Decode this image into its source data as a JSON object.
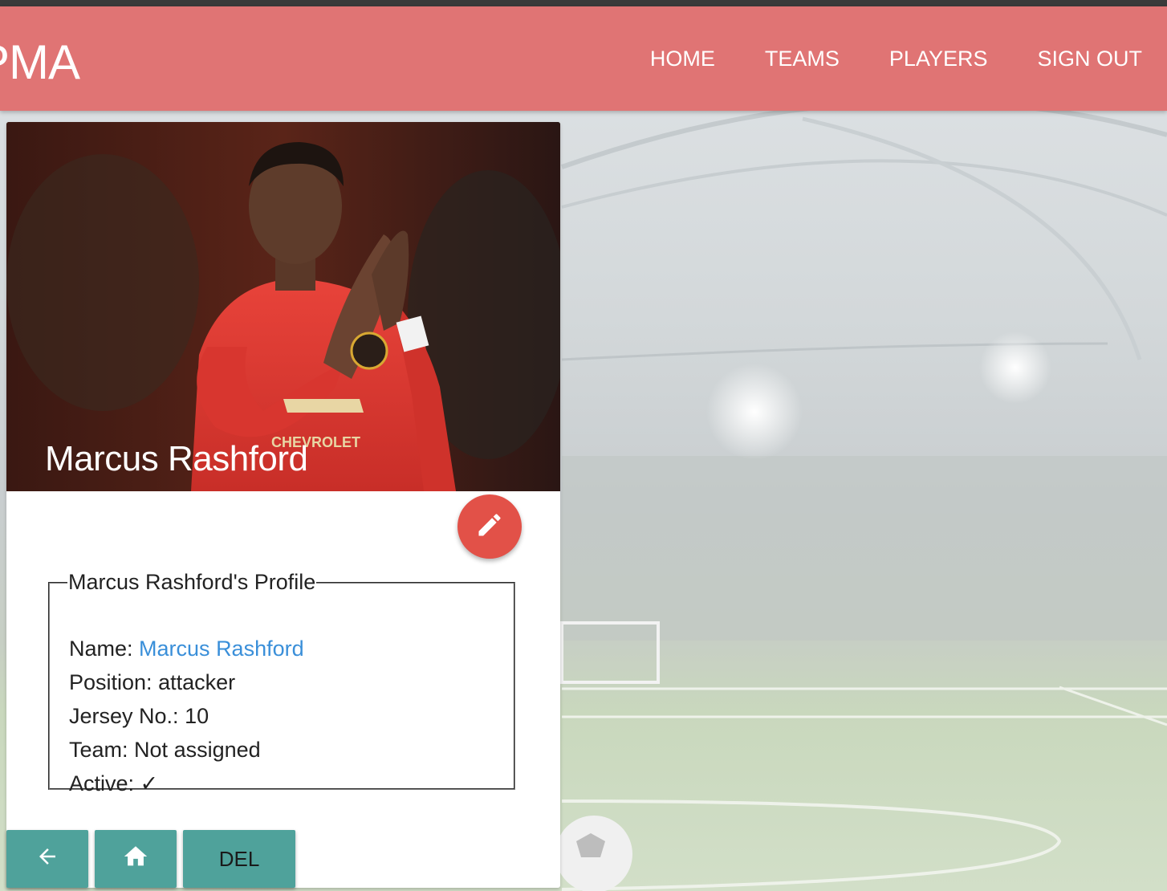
{
  "header": {
    "brand": "PMA",
    "nav": [
      "HOME",
      "TEAMS",
      "PLAYERS",
      "SIGN OUT"
    ]
  },
  "card": {
    "title": "Marcus Rashford",
    "profile": {
      "legend": "Marcus Rashford's Profile",
      "name_label": "Name:",
      "name_value": "Marcus Rashford",
      "position_label": "Position:",
      "position_value": "attacker",
      "jersey_label": "Jersey No.:",
      "jersey_value": "10",
      "team_label": "Team:",
      "team_value": "Not assigned",
      "active_label": "Active:",
      "active_value": "✓"
    },
    "buttons": {
      "back_icon": "arrow-left-icon",
      "home_icon": "home-icon",
      "del_label": "DEL"
    },
    "edit_icon": "pencil-icon"
  },
  "colors": {
    "header": "#e07474",
    "fab": "#e25148",
    "buttons": "#4fa29b",
    "link": "#3a8fd9"
  }
}
